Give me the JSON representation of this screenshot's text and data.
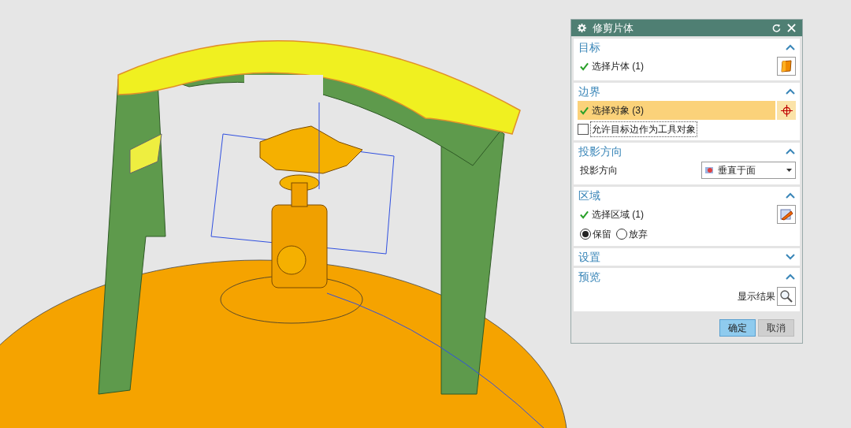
{
  "dialog": {
    "title": "修剪片体",
    "sections": [
      {
        "title": "目标",
        "expanded": true,
        "rows": [
          {
            "kind": "selection",
            "label": "选择片体 (1)",
            "done": true,
            "selected": false
          }
        ]
      },
      {
        "title": "边界",
        "expanded": true,
        "rows": [
          {
            "kind": "selection",
            "label": "选择对象 (3)",
            "done": true,
            "selected": true
          },
          {
            "kind": "checkbox",
            "label": "允许目标边作为工具对象",
            "checked": false
          }
        ]
      },
      {
        "title": "投影方向",
        "expanded": true,
        "rows": [
          {
            "kind": "dropdown",
            "label": "投影方向",
            "value": "垂直于面"
          }
        ]
      },
      {
        "title": "区域",
        "expanded": true,
        "rows": [
          {
            "kind": "selection",
            "label": "选择区域 (1)",
            "done": true,
            "selected": false
          },
          {
            "kind": "radio",
            "options": [
              {
                "label": "保留",
                "selected": true
              },
              {
                "label": "放弃",
                "selected": false
              }
            ]
          }
        ]
      },
      {
        "title": "设置",
        "expanded": false
      },
      {
        "title": "预览",
        "expanded": true,
        "rows": [
          {
            "kind": "action",
            "label": "显示结果"
          }
        ]
      }
    ],
    "buttons": [
      {
        "label": "确定",
        "primary": true
      },
      {
        "label": "取消",
        "primary": false
      }
    ]
  }
}
